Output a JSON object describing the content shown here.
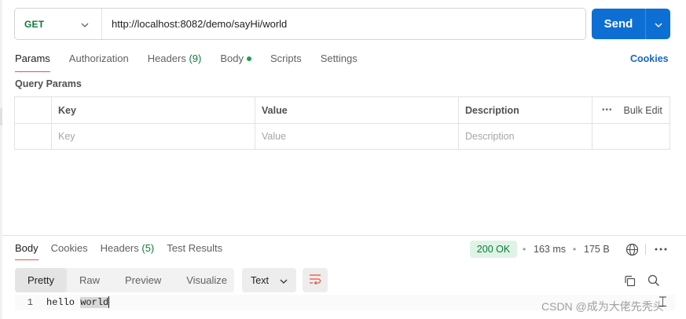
{
  "request": {
    "method": "GET",
    "url": "http://localhost:8082/demo/sayHi/world",
    "send_label": "Send"
  },
  "request_tabs": [
    {
      "label": "Params"
    },
    {
      "label": "Authorization"
    },
    {
      "label": "Headers",
      "count": "(9)"
    },
    {
      "label": "Body"
    },
    {
      "label": "Scripts"
    },
    {
      "label": "Settings"
    }
  ],
  "cookies_label": "Cookies",
  "query_params": {
    "title": "Query Params",
    "headers": [
      "Key",
      "Value",
      "Description"
    ],
    "bulk_edit": "Bulk Edit",
    "placeholders": [
      "Key",
      "Value",
      "Description"
    ]
  },
  "response": {
    "tabs": [
      {
        "label": "Body"
      },
      {
        "label": "Cookies"
      },
      {
        "label": "Headers",
        "count": "(5)"
      },
      {
        "label": "Test Results"
      }
    ],
    "status": "200 OK",
    "time": "163 ms",
    "size": "175 B",
    "view_modes": [
      "Pretty",
      "Raw",
      "Preview",
      "Visualize"
    ],
    "format": "Text",
    "line_number": "1",
    "body_plain": "hello ",
    "body_selected": "world"
  },
  "watermark": "CSDN @成为大佬先秃头",
  "colors": {
    "accent_send": "#0d6fd4",
    "method_get": "#0b7a3a",
    "tab_underline": "#e8563a",
    "status_bg": "#dff3e5"
  },
  "icons": [
    "chevron-down-icon",
    "globe-icon",
    "more-icon",
    "wrap-icon",
    "copy-icon",
    "search-icon"
  ]
}
